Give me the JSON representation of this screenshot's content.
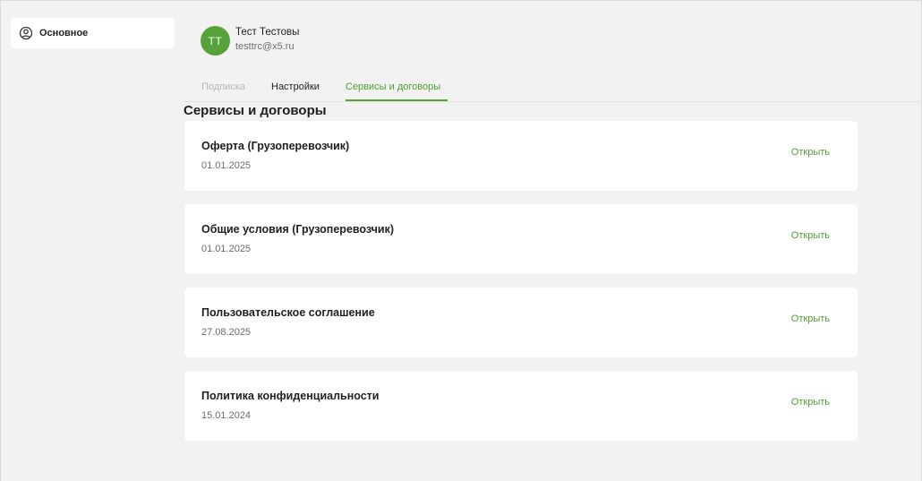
{
  "sidebar": {
    "items": [
      {
        "label": "Основное",
        "icon": "user-circle-icon"
      }
    ]
  },
  "profile": {
    "initials": "ТТ",
    "name": "Тест Тестовы",
    "email": "testtrc@x5.ru",
    "avatar_color": "#56a33a"
  },
  "tabs": [
    {
      "label": "Подписка",
      "state": "disabled"
    },
    {
      "label": "Настройки",
      "state": "normal"
    },
    {
      "label": "Сервисы и договоры",
      "state": "active"
    }
  ],
  "section": {
    "title": "Сервисы и договоры"
  },
  "documents": [
    {
      "title": "Оферта (Грузоперевозчик)",
      "date": "01.01.2025",
      "action": "Открыть"
    },
    {
      "title": "Общие условия (Грузоперевозчик)",
      "date": "01.01.2025",
      "action": "Открыть"
    },
    {
      "title": "Пользовательское соглашение",
      "date": "27.08.2025",
      "action": "Открыть"
    },
    {
      "title": "Политика конфиденциальности",
      "date": "15.01.2024",
      "action": "Открыть"
    }
  ],
  "colors": {
    "accent": "#4f9e30",
    "background": "#f2f2f2",
    "card": "#ffffff"
  }
}
